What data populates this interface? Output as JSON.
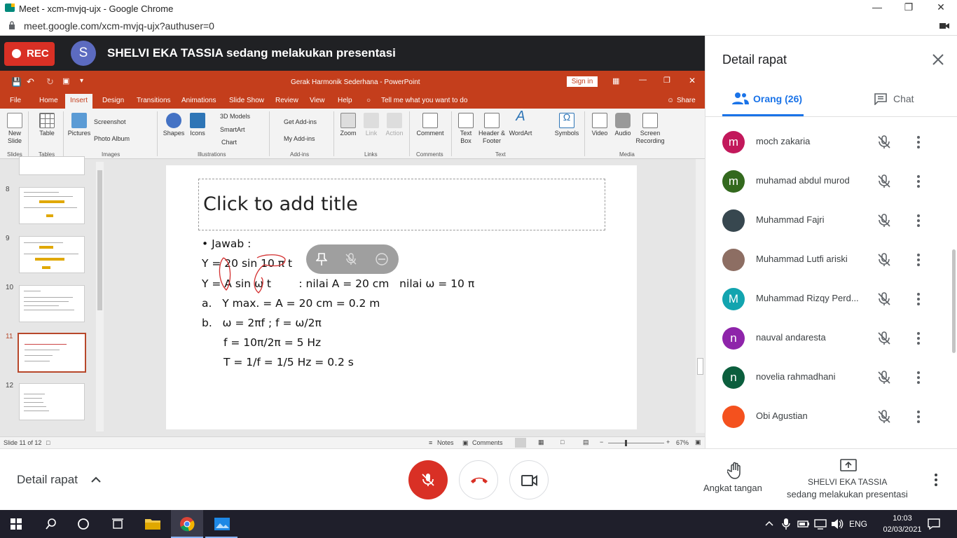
{
  "window": {
    "title": "Meet - xcm-mvjq-ujx - Google Chrome",
    "url": "meet.google.com/xcm-mvjq-ujx?authuser=0"
  },
  "topbar": {
    "rec_label": "REC",
    "presenter_initial": "S",
    "presenting_message": "SHELVI EKA TASSIA sedang melakukan presentasi"
  },
  "ppt": {
    "doc_title": "Gerak Harmonik Sederhana  -  PowerPoint",
    "signin": "Sign in",
    "share": "Share",
    "tell_me": "Tell me what you want to do",
    "tabs": [
      "File",
      "Home",
      "Insert",
      "Design",
      "Transitions",
      "Animations",
      "Slide Show",
      "Review",
      "View",
      "Help"
    ],
    "ribbon": {
      "new_slide": "New Slide",
      "table": "Table",
      "pictures": "Pictures",
      "screenshot": "Screenshot",
      "photo_album": "Photo Album",
      "shapes": "Shapes",
      "icons": "Icons",
      "models3d": "3D Models",
      "smartart": "SmartArt",
      "chart": "Chart",
      "get_addins": "Get Add-ins",
      "my_addins": "My Add-ins",
      "zoom": "Zoom",
      "link": "Link",
      "action": "Action",
      "comment": "Comment",
      "text_box": "Text Box",
      "header_footer": "Header & Footer",
      "wordart": "WordArt",
      "symbols": "Symbols",
      "video": "Video",
      "audio": "Audio",
      "screen_recording": "Screen Recording",
      "groups": [
        "Slides",
        "Tables",
        "Images",
        "Illustrations",
        "Add-ins",
        "Links",
        "Comments",
        "Text",
        "Media"
      ]
    },
    "thumbs": [
      "8",
      "9",
      "10",
      "11",
      "12"
    ],
    "slide": {
      "title_placeholder": "Click to add title",
      "lines": [
        "• Jawab :",
        "Y = 20 sin 10 π t",
        "Y = A sin ω t        : nilai A = 20 cm   nilai ω = 10 π",
        "a.   Y max. = A = 20 cm = 0.2 m",
        "b.   ω = 2πf ; f = ω/2π",
        "f = 10π/2π = 5 Hz",
        "T = 1/f = 1/5 Hz = 0.2 s"
      ]
    },
    "status": {
      "slide_of": "Slide 11 of 12",
      "notes": "Notes",
      "comments": "Comments",
      "zoom": "67%"
    }
  },
  "panel": {
    "title": "Detail rapat",
    "people_tab": "Orang (26)",
    "chat_tab": "Chat",
    "participants": [
      {
        "name": "moch zakaria",
        "initial": "m",
        "color": "#c2185b"
      },
      {
        "name": "muhamad abdul murod",
        "initial": "m",
        "color": "#33691e"
      },
      {
        "name": "Muhammad Fajri",
        "initial": "",
        "color": "#37474f"
      },
      {
        "name": "Muhammad Lutfi ariski",
        "initial": "",
        "color": "#8d6e63"
      },
      {
        "name": "Muhammad Rizqy Perd...",
        "initial": "M",
        "color": "#12a4af"
      },
      {
        "name": "nauval andaresta",
        "initial": "n",
        "color": "#8e24aa"
      },
      {
        "name": "novelia rahmadhani",
        "initial": "n",
        "color": "#0b5e3d"
      },
      {
        "name": "Obi Agustian",
        "initial": "",
        "color": "#f4511e"
      }
    ]
  },
  "bottom": {
    "meeting_details": "Detail rapat",
    "raise_hand": "Angkat tangan",
    "presenter_name": "SHELVI EKA TASSIA",
    "presenting": "sedang melakukan presentasi"
  },
  "taskbar": {
    "lang": "ENG",
    "time": "10:03",
    "date": "02/03/2021"
  }
}
